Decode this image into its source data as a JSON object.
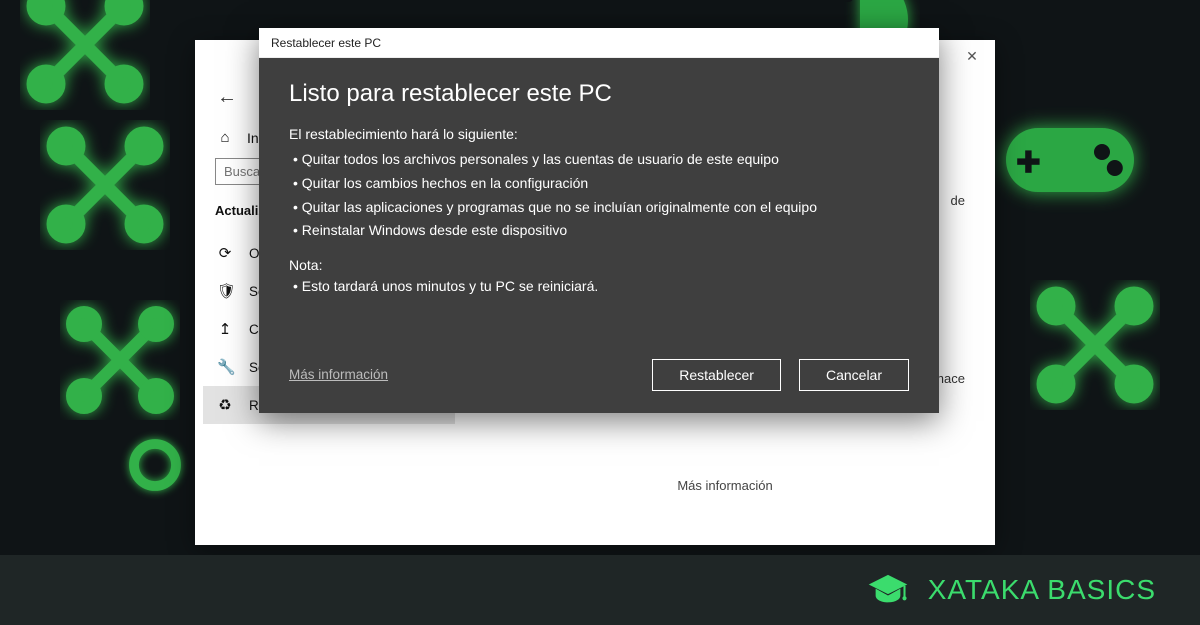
{
  "settings": {
    "back_arrow": "←",
    "home_label": "Inicio",
    "search_placeholder": "Buscar una opción de configuración",
    "section_title": "Actualización y seguridad",
    "nav_items": [
      {
        "icon": "⟳",
        "label": "Optimización de distribución"
      },
      {
        "icon": "🛡",
        "label": "Seguridad de Windows"
      },
      {
        "icon": "↥",
        "label": "Copia de seguridad"
      },
      {
        "icon": "🔧",
        "label": "Solucionar problemas"
      },
      {
        "icon": "♻",
        "label": "Recuperación"
      }
    ],
    "main_side_text_1": "de",
    "main_side_text_2": "hace",
    "more_info": "Más información"
  },
  "dialog": {
    "window_title": "Restablecer este PC",
    "heading": "Listo para restablecer este PC",
    "intro": "El restablecimiento hará lo siguiente:",
    "bullets": [
      " Quitar todos los archivos personales y las cuentas de usuario de este equipo",
      " Quitar los cambios hechos en la configuración",
      " Quitar las aplicaciones y programas que no se incluían originalmente con el equipo",
      "Reinstalar Windows desde este dispositivo"
    ],
    "note_title": "Nota:",
    "note_bullets": [
      "Esto tardará unos minutos y tu PC se reiniciará."
    ],
    "more_info": "Más información",
    "reset_label": "Restablecer",
    "cancel_label": "Cancelar"
  },
  "brand": {
    "text": "XATAKA BASICS"
  },
  "colors": {
    "accent": "#3bdc6d",
    "dialog_bg": "#3f3f3f"
  }
}
